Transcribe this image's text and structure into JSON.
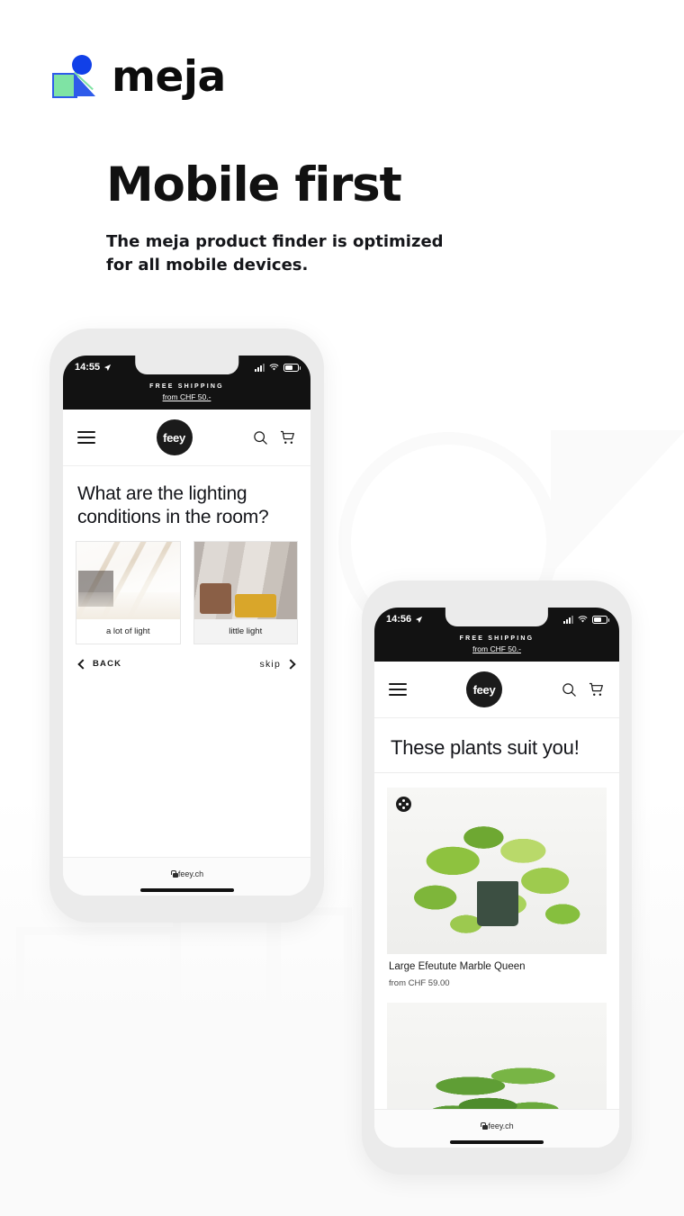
{
  "brand": {
    "name": "meja",
    "logo_icon": "meja-logo-mark",
    "colors": {
      "blue": "#1140e8",
      "green": "#7fe3a4",
      "dark": "#111111"
    }
  },
  "hero": {
    "title": "Mobile first",
    "subtitle": "The meja product finder is optimized for all mobile devices."
  },
  "phones": [
    {
      "id": "phone-question",
      "status": {
        "time": "14:55",
        "location_icon": "location-arrow-icon",
        "signal_icon": "signal-bars-icon",
        "wifi_icon": "wifi-icon",
        "battery_icon": "battery-icon"
      },
      "promo": {
        "line1": "FREE SHIPPING",
        "line2": "from CHF 50.-"
      },
      "nav": {
        "menu_icon": "hamburger-menu-icon",
        "logo_text": "feey",
        "search_icon": "search-icon",
        "cart_icon": "cart-icon"
      },
      "question": "What are the lighting conditions in the room?",
      "options": [
        {
          "label": "a lot of light",
          "image_alt": "bright-attic-room-photo"
        },
        {
          "label": "little light",
          "image_alt": "dim-living-room-photo"
        }
      ],
      "controls": {
        "back_label": "BACK",
        "back_icon": "chevron-left-icon",
        "skip_label": "skip",
        "skip_icon": "chevron-right-icon"
      },
      "browser": {
        "url": "feey.ch",
        "lock_icon": "lock-icon"
      }
    },
    {
      "id": "phone-results",
      "status": {
        "time": "14:56",
        "location_icon": "location-arrow-icon",
        "signal_icon": "signal-bars-icon",
        "wifi_icon": "wifi-icon",
        "battery_icon": "battery-icon"
      },
      "promo": {
        "line1": "FREE SHIPPING",
        "line2": "from CHF 50.-"
      },
      "nav": {
        "menu_icon": "hamburger-menu-icon",
        "logo_text": "feey",
        "search_icon": "search-icon",
        "cart_icon": "cart-icon"
      },
      "results_title": "These plants suit you!",
      "products": [
        {
          "name": "Large Efeutute Marble Queen",
          "price": "from CHF 59.00",
          "badge_icon": "plant-care-badge-icon",
          "image_alt": "variegated-pothos-plant-photo"
        },
        {
          "name": "",
          "price": "",
          "image_alt": "fern-plant-photo"
        }
      ],
      "browser": {
        "url": "feey.ch",
        "lock_icon": "lock-icon"
      }
    }
  ]
}
